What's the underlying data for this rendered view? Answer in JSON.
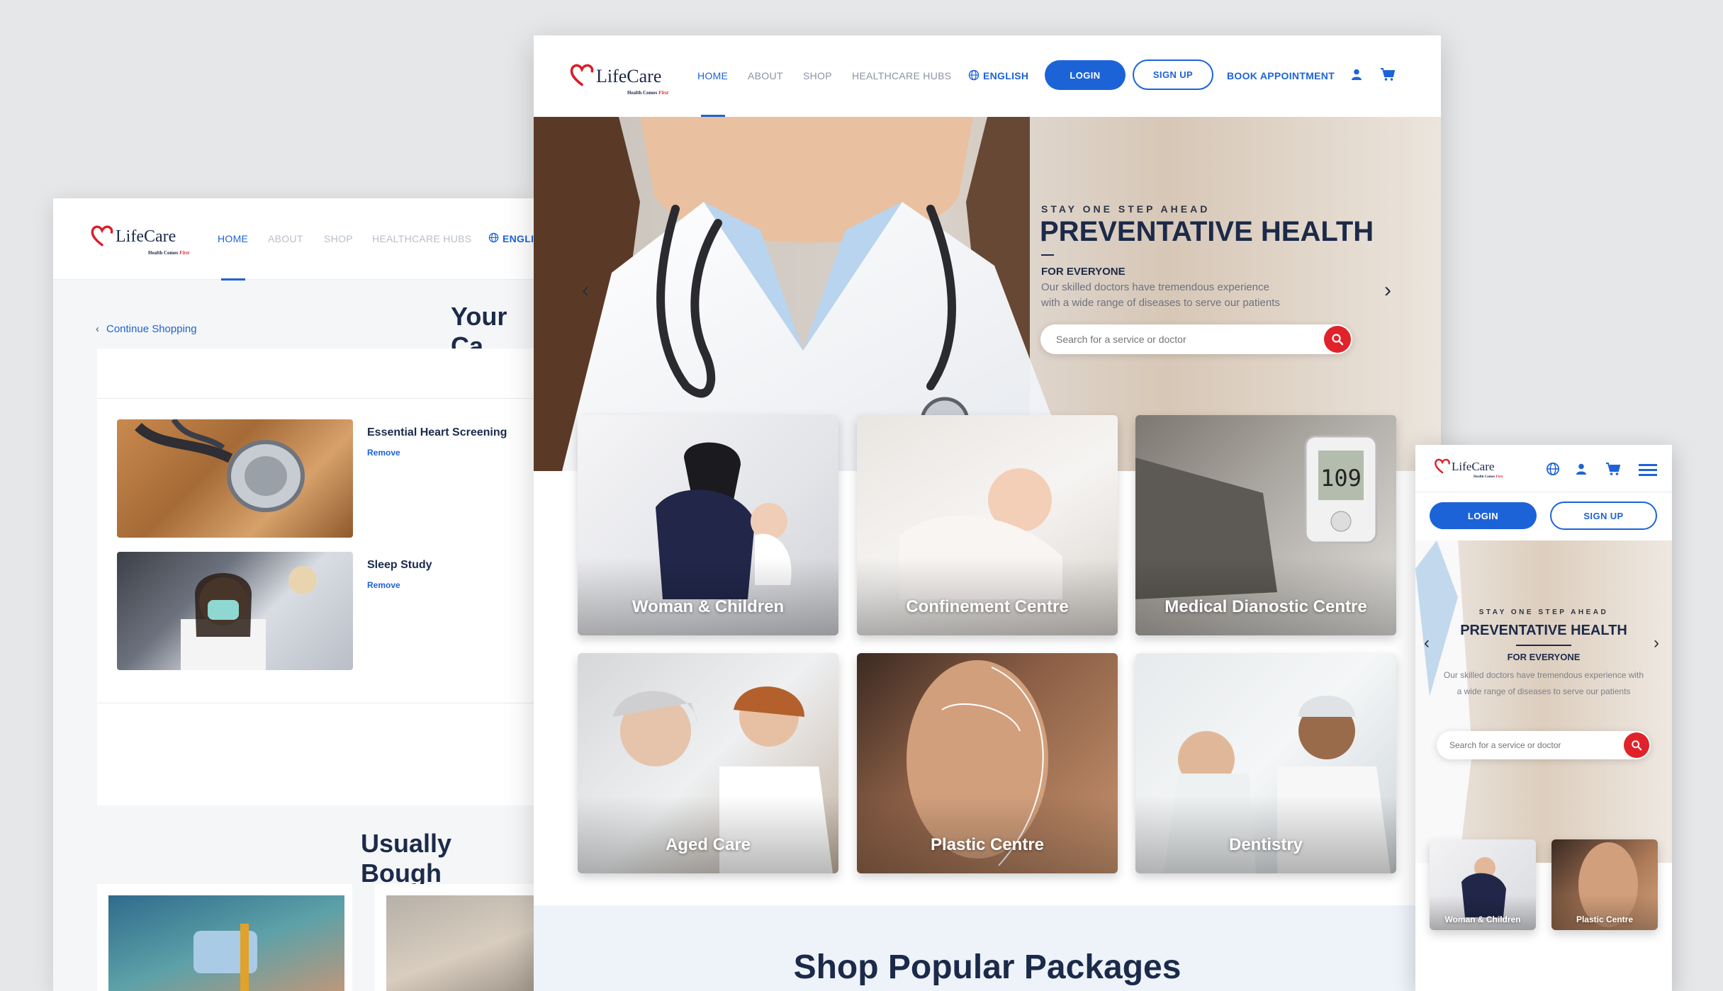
{
  "brand": {
    "name": "LifeCare",
    "tagline_main": "Health Comes ",
    "tagline_em": "First"
  },
  "colors": {
    "primary": "#1d63d8",
    "brand_red": "#d81f2a",
    "dark_text": "#1c2a4a",
    "background": "#e6e7e9"
  },
  "cart_page": {
    "nav": [
      "HOME",
      "ABOUT",
      "SHOP",
      "HEALTHCARE HUBS",
      "ENGLI"
    ],
    "continue_shopping": "Continue Shopping",
    "title": "Your Ca",
    "items": [
      {
        "name": "Essential Heart Screening",
        "remove": "Remove"
      },
      {
        "name": "Sleep Study",
        "remove": "Remove"
      }
    ],
    "usually_bought": "Usually Bough"
  },
  "desktop": {
    "nav": {
      "home": "HOME",
      "about": "ABOUT",
      "shop": "SHOP",
      "hubs": "HEALTHCARE HUBS",
      "language": "ENGLISH",
      "login": "LOGIN",
      "signup": "SIGN UP",
      "book": "BOOK APPOINTMENT"
    },
    "hero": {
      "eyebrow": "STAY ONE STEP AHEAD",
      "title": "PREVENTATIVE HEALTH",
      "subtitle": "FOR EVERYONE",
      "desc_line1": "Our skilled doctors have tremendous experience",
      "desc_line2": "with a wide range of diseases to serve our patients",
      "search_placeholder": "Search for a service or doctor"
    },
    "hubs": [
      "Woman & Children",
      "Confinement Centre",
      "Medical Dianostic Centre",
      "Aged Care",
      "Plastic Centre",
      "Dentistry"
    ],
    "packages_title": "Shop Popular Packages"
  },
  "mobile": {
    "login": "LOGIN",
    "signup": "SIGN UP",
    "hero": {
      "eyebrow": "STAY ONE STEP AHEAD",
      "title": "PREVENTATIVE HEALTH",
      "subtitle": "FOR EVERYONE",
      "desc": "Our skilled doctors have tremendous experience with a wide range of diseases to serve our patients",
      "search_placeholder": "Search for a service or doctor"
    },
    "hubs": [
      "Woman & Children",
      "Plastic Centre"
    ]
  },
  "icons": [
    "heart-logo-icon",
    "globe-icon",
    "user-icon",
    "cart-icon",
    "menu-icon",
    "search-icon",
    "chevron-left-icon",
    "chevron-right-icon"
  ]
}
